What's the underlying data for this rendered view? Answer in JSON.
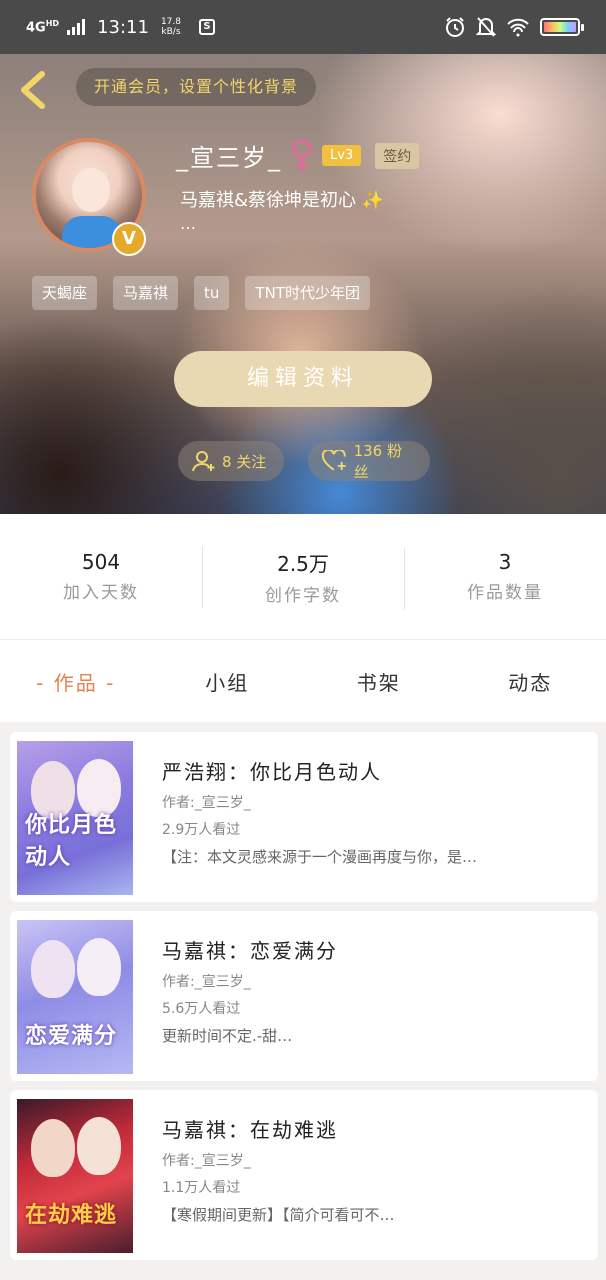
{
  "status_bar": {
    "network": "4G",
    "network_sup": "HD",
    "time": "13:11",
    "speed_value": "17.8",
    "speed_unit": "kB/s",
    "app_icon": "S"
  },
  "header": {
    "vip_prompt": "开通会员，设置个性化背景",
    "username": "_宣三岁_",
    "gender_symbol": "♀",
    "level": "Lv3",
    "signed": "签约",
    "bio": "马嘉祺&蔡徐坤是初心 ✨",
    "bio_more": "…",
    "verified_badge": "V",
    "tags": [
      "天蝎座",
      "马嘉祺",
      "tu",
      "TNT时代少年团"
    ],
    "edit_button": "编辑资料",
    "follow_label": "8 关注",
    "fans_label": "136 粉丝"
  },
  "stats": [
    {
      "value": "504",
      "label": "加入天数"
    },
    {
      "value": "2.5万",
      "label": "创作字数"
    },
    {
      "value": "3",
      "label": "作品数量"
    }
  ],
  "tabs": [
    {
      "label": "- 作品 -",
      "active": true
    },
    {
      "label": "小组",
      "active": false
    },
    {
      "label": "书架",
      "active": false
    },
    {
      "label": "动态",
      "active": false
    }
  ],
  "works": [
    {
      "title": "严浩翔：你比月色动人",
      "author": "作者:_宣三岁_",
      "views": "2.9万人看过",
      "description": "【注：本文灵感来源于一个漫画再度与你，是…",
      "cover_text": "你比月色动人"
    },
    {
      "title": "马嘉祺：恋爱满分",
      "author": "作者:_宣三岁_",
      "views": "5.6万人看过",
      "description": "更新时间不定.-甜…",
      "cover_text": "恋爱满分"
    },
    {
      "title": "马嘉祺：在劫难逃",
      "author": "作者:_宣三岁_",
      "views": "1.1万人看过",
      "description": "【寒假期间更新】【简介可看可不…",
      "cover_text": "在劫难逃"
    }
  ],
  "colors": {
    "accent": "#e5834e",
    "gold": "#f3d66a",
    "edit_button": "#e8d9b2",
    "gender": "#e06a9a"
  }
}
